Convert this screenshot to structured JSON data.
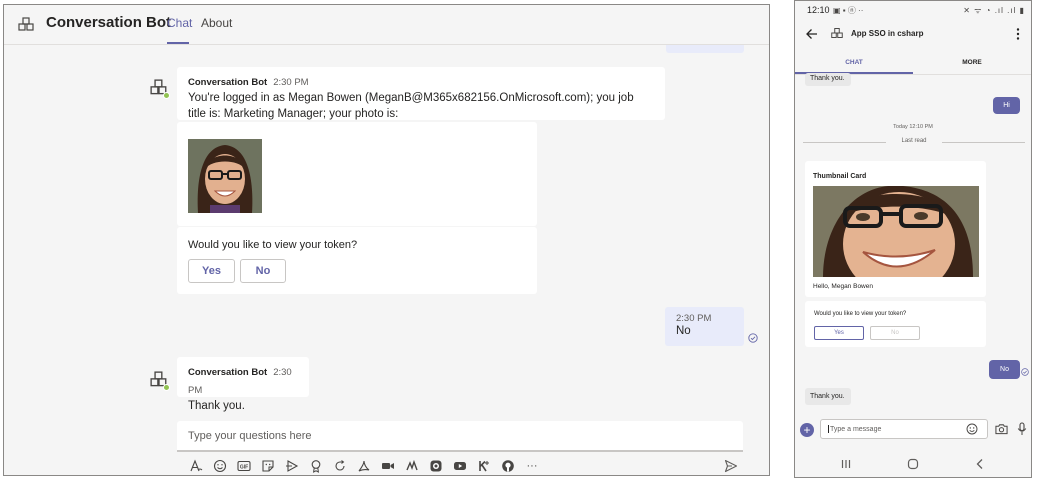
{
  "desktop": {
    "app_title": "Conversation Bot",
    "tabs": [
      {
        "label": "Chat",
        "active": true
      },
      {
        "label": "About",
        "active": false
      }
    ],
    "messages": {
      "login": {
        "sender": "Conversation Bot",
        "time": "2:30 PM",
        "text": "You're logged in as Megan Bowen (MeganB@M365x682156.OnMicrosoft.com); you job title is: Marketing Manager; your photo is:"
      },
      "prompt": {
        "question": "Would you like to view your token?",
        "yes_label": "Yes",
        "no_label": "No"
      },
      "user_reply": {
        "time": "2:30 PM",
        "text": "No"
      },
      "thanks": {
        "sender": "Conversation Bot",
        "time": "2:30 PM",
        "text": "Thank you."
      }
    },
    "compose": {
      "placeholder": "Type your questions here",
      "toolbar_icons": [
        "format-icon",
        "emoji-icon",
        "gif-icon",
        "sticker-icon",
        "meet-icon",
        "praise-icon",
        "loop-icon",
        "pdf-icon",
        "video-icon",
        "stream-icon",
        "record-icon",
        "youtube-icon",
        "kudos-icon",
        "github-icon",
        "more-icon"
      ],
      "gif_label": "GIF",
      "more_label": "···"
    }
  },
  "mobile": {
    "status_bar": {
      "time": "12:10",
      "left_icons": "▣ ▪ ⓝ ··",
      "right_icons": "✕ ᯤ ◔ .ıl .ıl ▮"
    },
    "header": {
      "title": "App SSO in csharp"
    },
    "tabs": [
      {
        "label": "CHAT",
        "active": true
      },
      {
        "label": "MORE",
        "active": false
      }
    ],
    "messages": {
      "thanks_top": "Thank you.",
      "hi": "Hi",
      "timestamp": "Today 12:10 PM",
      "last_read": "Last read",
      "card": {
        "title": "Thumbnail Card",
        "caption": "Hello, Megan Bowen"
      },
      "prompt": {
        "question": "Would you like to view your token?",
        "yes_label": "Yes",
        "no_label": "No"
      },
      "no_reply": "No",
      "thanks": "Thank you."
    },
    "compose": {
      "placeholder": "Type a message"
    }
  },
  "colors": {
    "accent": "#6264a7",
    "user_bubble": "#e8ebfa",
    "presence": "#92c353",
    "background": "#f5f5f5"
  }
}
